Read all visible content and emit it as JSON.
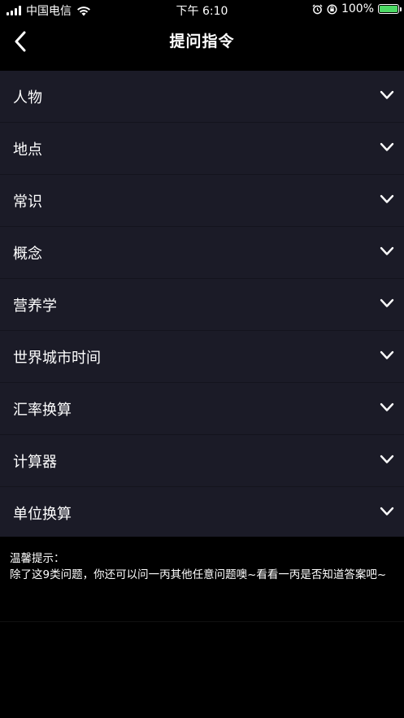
{
  "status_bar": {
    "carrier": "中国电信",
    "time": "下午 6:10",
    "battery_percent": "100%",
    "battery_color": "#4cd964"
  },
  "nav": {
    "title": "提问指令",
    "back_icon": "chevron-left-icon"
  },
  "categories": [
    {
      "label": "人物"
    },
    {
      "label": "地点"
    },
    {
      "label": "常识"
    },
    {
      "label": "概念"
    },
    {
      "label": "营养学"
    },
    {
      "label": "世界城市时间"
    },
    {
      "label": "汇率换算"
    },
    {
      "label": "计算器"
    },
    {
      "label": "单位换算"
    }
  ],
  "tip": {
    "heading": "温馨提示：",
    "body": "除了这9类问题，你还可以问一丙其他任意问题噢~看看一丙是否知道答案吧~"
  },
  "colors": {
    "background": "#000000",
    "list_background": "#1b1b27",
    "text": "#ffffff"
  }
}
